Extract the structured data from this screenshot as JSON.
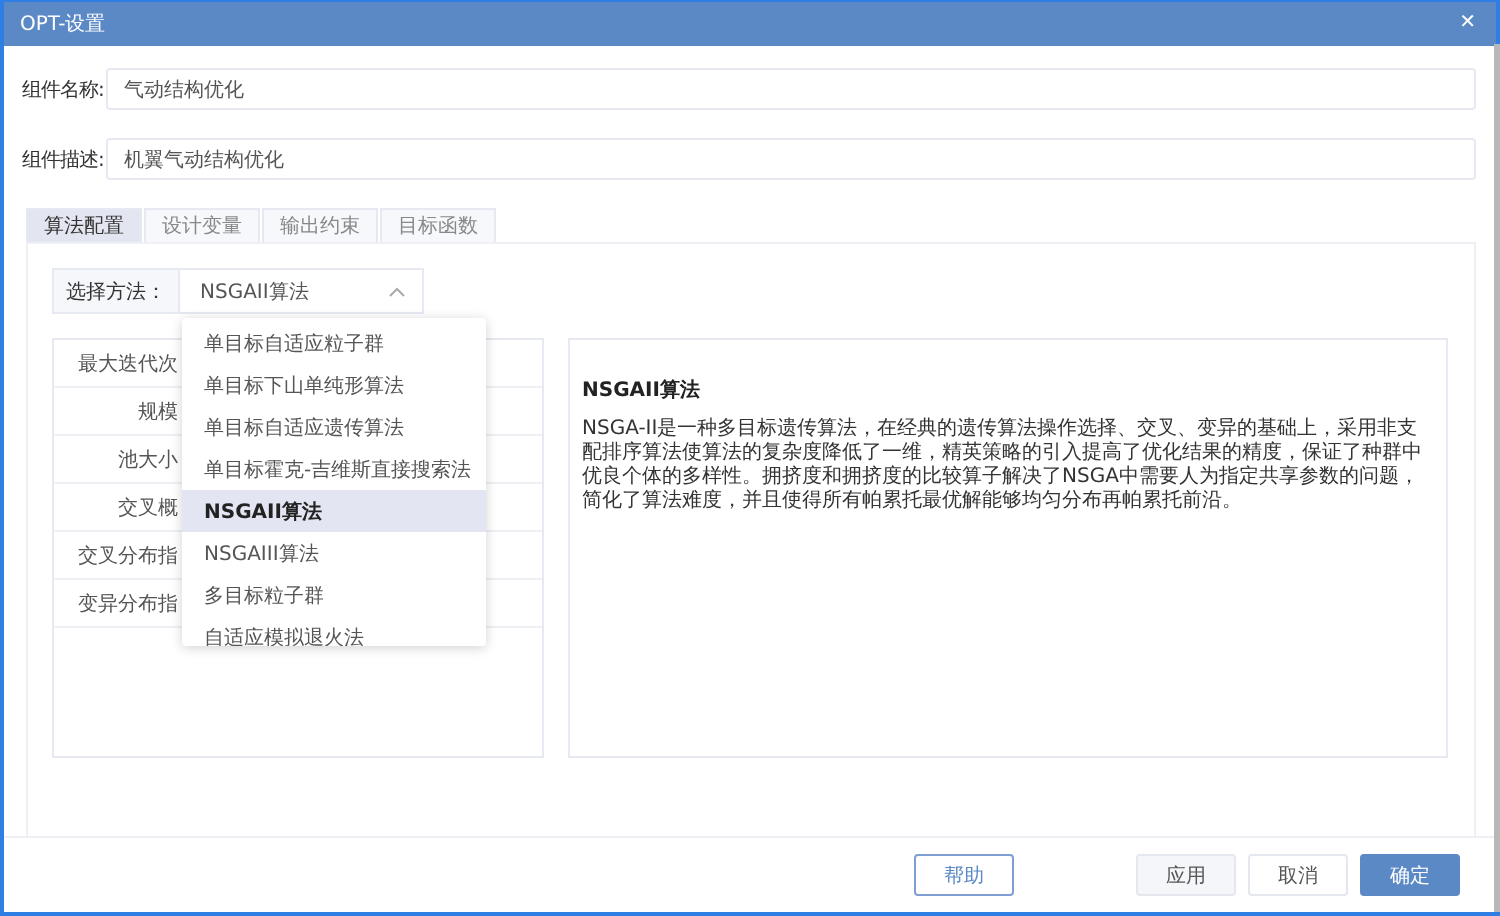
{
  "window": {
    "title": "OPT-设置",
    "close": "✕"
  },
  "fields": [
    {
      "label": "组件名称:",
      "value": "气动结构优化"
    },
    {
      "label": "组件描述:",
      "value": "机翼气动结构优化"
    }
  ],
  "tabs": [
    {
      "label": "算法配置",
      "selected": true
    },
    {
      "label": "设计变量",
      "selected": false
    },
    {
      "label": "输出约束",
      "selected": false
    },
    {
      "label": "目标函数",
      "selected": false
    }
  ],
  "method": {
    "label": "选择方法：",
    "value": "NSGAII算法",
    "expanded": true
  },
  "options": [
    {
      "label": "单目标自适应粒子群",
      "selected": false
    },
    {
      "label": "单目标下山单纯形算法",
      "selected": false
    },
    {
      "label": "单目标自适应遗传算法",
      "selected": false
    },
    {
      "label": "单目标霍克-吉维斯直接搜索法",
      "selected": false
    },
    {
      "label": "NSGAII算法",
      "selected": true
    },
    {
      "label": "NSGAIII算法",
      "selected": false
    },
    {
      "label": "多目标粒子群",
      "selected": false
    },
    {
      "label": "自适应模拟退火法",
      "selected": false
    }
  ],
  "params": [
    "最大迭代次",
    "规模",
    "池大小",
    "交叉概",
    "交叉分布指",
    "变异分布指"
  ],
  "description": {
    "title": "NSGAII算法",
    "text": "NSGA-II是一种多目标遗传算法，在经典的遗传算法操作选择、交叉、变异的基础上，采用非支配排序算法使算法的复杂度降低了一维，精英策略的引入提高了优化结果的精度，保证了种群中优良个体的多样性。拥挤度和拥挤度的比较算子解决了NSGA中需要人为指定共享参数的问题，简化了算法难度，并且使得所有帕累托最优解能够均匀分布再帕累托前沿。"
  },
  "buttons": [
    {
      "label": "帮助",
      "kind": "outline"
    },
    {
      "label": "应用",
      "kind": "light"
    },
    {
      "label": "取消",
      "kind": "plain"
    },
    {
      "label": "确定",
      "kind": "primary"
    }
  ]
}
